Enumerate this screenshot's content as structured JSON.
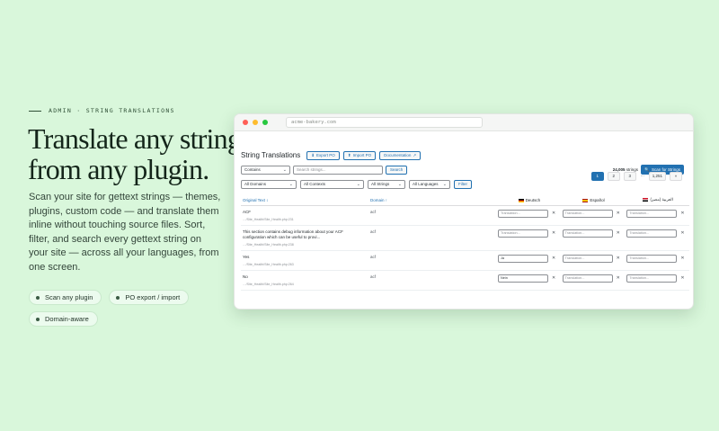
{
  "hero": {
    "eyebrow": "ADMIN · STRING TRANSLATIONS",
    "headline_line1": "Translate any string,",
    "headline_line2": "from any plugin.",
    "body": "Scan your site for gettext strings — themes, plugins, custom code — and translate them inline without touching source files. Sort, filter, and search every gettext string on your site — across all your languages, from one screen.",
    "chips": [
      "Scan any plugin",
      "PO export / import",
      "Domain-aware"
    ]
  },
  "browser": {
    "url": "acme-bakery.com"
  },
  "app": {
    "title": "String Translations",
    "export_label": "Export PO",
    "import_label": "Import PO",
    "docs_label": "Documentation",
    "match_mode": "Contains",
    "search_placeholder": "Search strings...",
    "search_label": "Search",
    "count_number": "24,005",
    "count_unit": "strings",
    "scan_label": "Scan for Strings",
    "filters": {
      "domains": "All Domains",
      "contexts": "All Contexts",
      "strings": "All Strings",
      "languages": "All Languages",
      "filter_label": "Filter"
    },
    "pagination": [
      "1",
      "2",
      "3",
      "…",
      "1,251",
      "»"
    ],
    "columns": {
      "original": "Original Text ↕",
      "domain": "Domain ↑",
      "lang1": "Deutsch",
      "lang2": "Español",
      "lang3": "العربية (مصر)"
    },
    "rows": [
      {
        "text": "ACF",
        "location": "…/Site_Health/Site_Health.php:231",
        "domain": "acf",
        "translations": [
          "Translation...",
          "Translation...",
          "Translation..."
        ]
      },
      {
        "text": "This section contains debug information about your ACF configuration which can be useful to provi...",
        "location": "…/Site_Health/Site_Health.php:238",
        "domain": "acf",
        "translations": [
          "Translation...",
          "Translation...",
          "Translation..."
        ]
      },
      {
        "text": "Yes",
        "location": "…/Site_Health/Site_Health.php:263",
        "domain": "acf",
        "translations": [
          "Ja",
          "Translation...",
          "Translation..."
        ]
      },
      {
        "text": "No",
        "location": "…/Site_Health/Site_Health.php:264",
        "domain": "acf",
        "translations": [
          "Nein",
          "Translation...",
          "Translation..."
        ]
      }
    ]
  },
  "icons": [
    "chevron-down-icon",
    "close-icon",
    "search-icon",
    "download-icon",
    "upload-icon",
    "external-link-icon"
  ],
  "colors": {
    "background": "#d9f7db",
    "accent": "#2271b1"
  }
}
